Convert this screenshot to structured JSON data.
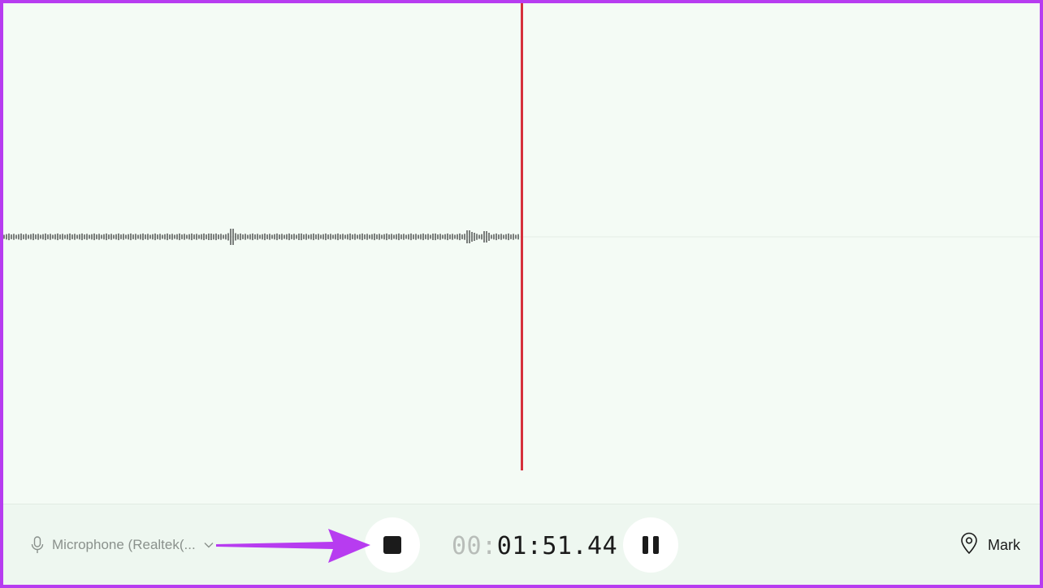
{
  "recording": {
    "microphone_label": "Microphone (Realtek(...",
    "timer_dim": "00:",
    "timer_main": "01:51.44",
    "mark_label": "Mark"
  },
  "icons": {
    "microphone": "microphone-icon",
    "chevron": "chevron-down-icon",
    "stop": "stop-icon",
    "pause": "pause-icon",
    "mark": "location-pin-icon"
  },
  "colors": {
    "playhead": "#d6303c",
    "annotation_arrow": "#b73cf0",
    "waveform": "#5c5f5d"
  }
}
